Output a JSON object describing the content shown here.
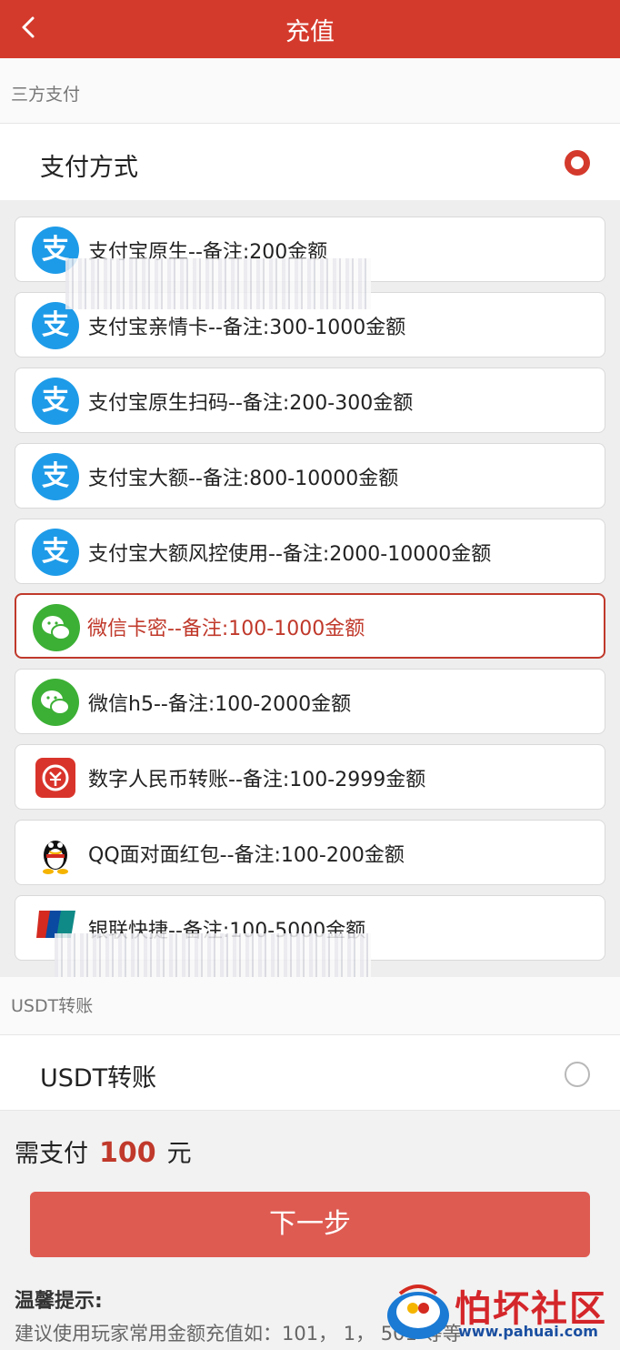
{
  "header": {
    "title": "充值",
    "back_icon": "chevron-left-icon"
  },
  "section_third_party": {
    "label": "三方支付",
    "method_label": "支付方式",
    "selected": true
  },
  "options": [
    {
      "icon": "alipay-icon",
      "glyph": "支",
      "text": "支付宝原生--备注:200金额",
      "selected": false
    },
    {
      "icon": "alipay-icon",
      "glyph": "支",
      "text": "支付宝亲情卡--备注:300-1000金额",
      "selected": false
    },
    {
      "icon": "alipay-icon",
      "glyph": "支",
      "text": "支付宝原生扫码--备注:200-300金额",
      "selected": false
    },
    {
      "icon": "alipay-icon",
      "glyph": "支",
      "text": "支付宝大额--备注:800-10000金额",
      "selected": false
    },
    {
      "icon": "alipay-icon",
      "glyph": "支",
      "text": "支付宝大额风控使用--备注:2000-10000金额",
      "selected": false
    },
    {
      "icon": "wechat-icon",
      "text": "微信卡密--备注:100-1000金额",
      "selected": true
    },
    {
      "icon": "wechat-icon",
      "text": "微信h5--备注:100-2000金额",
      "selected": false
    },
    {
      "icon": "digital-rmb-icon",
      "text": "数字人民币转账--备注:100-2999金额",
      "selected": false
    },
    {
      "icon": "qq-icon",
      "text": "QQ面对面红包--备注:100-200金额",
      "selected": false
    },
    {
      "icon": "unionpay-icon",
      "text": "银联快捷--备注:100-5000金额",
      "selected": false
    }
  ],
  "section_usdt": {
    "label": "USDT转账",
    "method_label": "USDT转账",
    "selected": false
  },
  "payment": {
    "prefix": "需支付",
    "amount": "100",
    "unit": "元"
  },
  "next_button": {
    "label": "下一步"
  },
  "tips": {
    "title": "温馨提示:",
    "text": "建议使用玩家常用金额充值如：101，     1，  501 等等"
  },
  "watermark": {
    "text": "怕坏社区",
    "url": "www.pahuai.com"
  },
  "colors": {
    "brand_red": "#d43a2c",
    "button": "#de5b52",
    "alipay": "#1e9be8",
    "wechat": "#3cb035"
  }
}
